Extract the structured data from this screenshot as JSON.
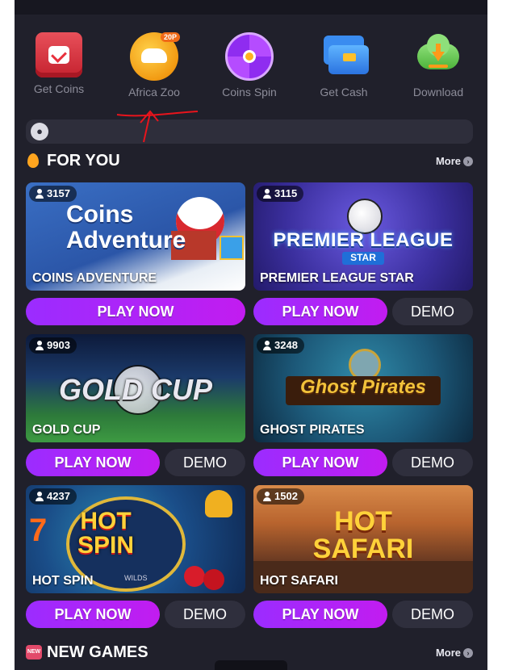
{
  "shortcuts": [
    {
      "label": "Get Coins",
      "icon": "calendar-check-icon"
    },
    {
      "label": "Africa Zoo",
      "icon": "elephant-icon",
      "badge": "20P"
    },
    {
      "label": "Coins Spin",
      "icon": "spin-wheel-icon"
    },
    {
      "label": "Get Cash",
      "icon": "credit-card-icon"
    },
    {
      "label": "Download",
      "icon": "cloud-download-icon"
    }
  ],
  "for_you": {
    "title": "FOR YOU",
    "more": "More"
  },
  "games": [
    {
      "name": "COINS ADVENTURE",
      "players": "3157",
      "art_line1": "Coins",
      "art_line2": "Adventure"
    },
    {
      "name": "PREMIER LEAGUE STAR",
      "players": "3115",
      "art_line1": "PREMIER LEAGUE",
      "art_line2": "STAR"
    },
    {
      "name": "GOLD CUP",
      "players": "9903",
      "art_line1": "GOLD CUP"
    },
    {
      "name": "GHOST PIRATES",
      "players": "3248",
      "art_line1": "Ghost Pirates"
    },
    {
      "name": "HOT SPIN",
      "players": "4237",
      "art_line1": "HOT",
      "art_line2": "SPIN",
      "art_extra": "7",
      "art_wilds": "WILDS"
    },
    {
      "name": "HOT SAFARI",
      "players": "1502",
      "art_line1": "HOT",
      "art_line2": "SAFARI"
    }
  ],
  "buttons": {
    "play_now": "PLAY NOW",
    "demo": "DEMO"
  },
  "new_games": {
    "title": "NEW GAMES",
    "more": "More",
    "badge": "NEW"
  },
  "colors": {
    "background": "#20202b",
    "play_button": "#b024f8",
    "demo_button": "#2f2f3d",
    "annotation": "#e8141c"
  }
}
